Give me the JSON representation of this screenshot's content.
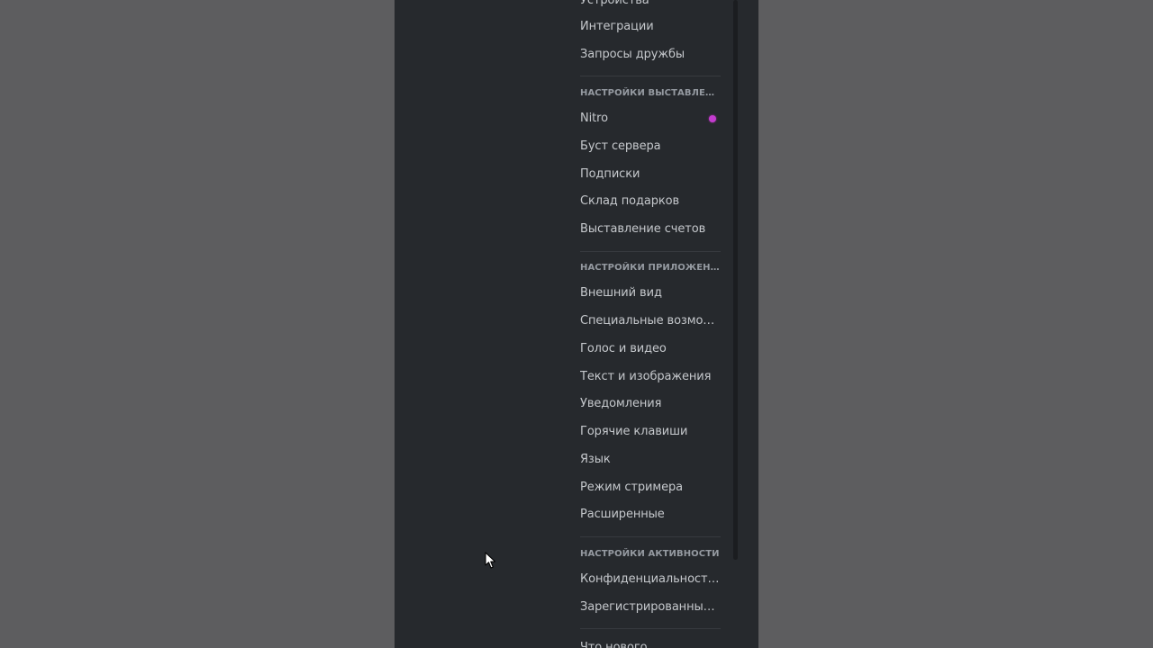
{
  "sections": {
    "user_settings_tail": {
      "items": [
        "Устройства",
        "Интеграции",
        "Запросы дружбы"
      ]
    },
    "billing": {
      "header": "НАСТРОЙКИ ВЫСТАВЛЕН...",
      "items": [
        "Nitro",
        "Буст сервера",
        "Подписки",
        "Склад подарков",
        "Выставление счетов"
      ]
    },
    "app": {
      "header": "НАСТРОЙКИ ПРИЛОЖЕНИЯ",
      "items": [
        "Внешний вид",
        "Специальные возмож...",
        "Голос и видео",
        "Текст и изображения",
        "Уведомления",
        "Горячие клавиши",
        "Язык",
        "Режим стримера",
        "Расширенные"
      ]
    },
    "activity": {
      "header": "НАСТРОЙКИ АКТИВНОСТИ",
      "items": [
        "Конфиденциальность ...",
        "Зарегистрированные ..."
      ]
    },
    "footer": {
      "items": [
        "Что нового"
      ]
    }
  },
  "colors": {
    "background": "#26292d",
    "text": "#c5c8cc",
    "header": "#959aa1",
    "nitro_badge": "#c33ccf"
  },
  "icons": {
    "nitro_badge": "nitro-badge-icon",
    "cursor": "mouse-cursor-icon"
  }
}
